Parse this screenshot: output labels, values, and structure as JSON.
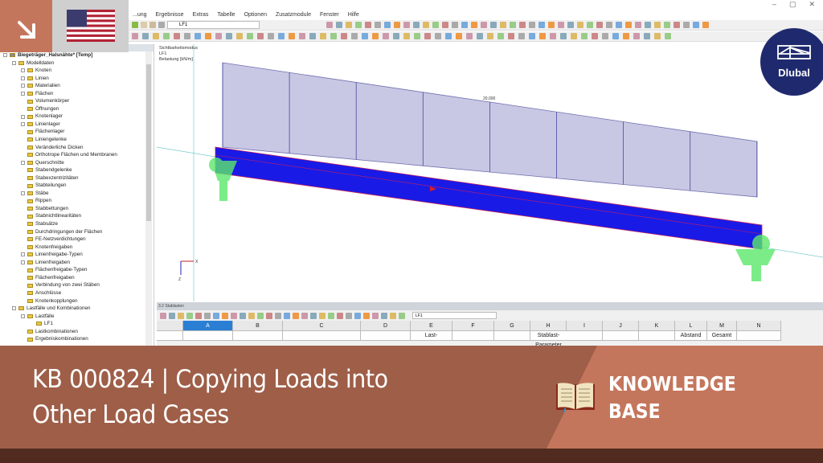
{
  "window": {
    "minimize": "–",
    "maximize": "▢",
    "close": "✕"
  },
  "menu": [
    "...ung",
    "Ergebnisse",
    "Extras",
    "Tabelle",
    "Optionen",
    "Zusatzmodule",
    "Fenster",
    "Hilfe"
  ],
  "toolbar": {
    "loadcase": "LF1"
  },
  "tree": {
    "root": "Biegeträger_Halsnähte* [Temp]",
    "items": [
      {
        "label": "Modelldaten",
        "level": 1,
        "expand": true
      },
      {
        "label": "Knoten",
        "level": 2,
        "expand": true
      },
      {
        "label": "Linien",
        "level": 2,
        "expand": true
      },
      {
        "label": "Materialien",
        "level": 2,
        "expand": true
      },
      {
        "label": "Flächen",
        "level": 2,
        "expand": true
      },
      {
        "label": "Volumenkörper",
        "level": 2
      },
      {
        "label": "Öffnungen",
        "level": 2
      },
      {
        "label": "Knotenlager",
        "level": 2,
        "expand": true
      },
      {
        "label": "Linienlager",
        "level": 2,
        "expand": true
      },
      {
        "label": "Flächenlager",
        "level": 2
      },
      {
        "label": "Liniengelenke",
        "level": 2
      },
      {
        "label": "Veränderliche Dicken",
        "level": 2
      },
      {
        "label": "Orthotrope Flächen und Membranen",
        "level": 2
      },
      {
        "label": "Querschnitte",
        "level": 2,
        "expand": true
      },
      {
        "label": "Stabendgelenke",
        "level": 2
      },
      {
        "label": "Stabexzentrizitäten",
        "level": 2
      },
      {
        "label": "Stabteilungen",
        "level": 2
      },
      {
        "label": "Stäbe",
        "level": 2,
        "expand": true
      },
      {
        "label": "Rippen",
        "level": 2
      },
      {
        "label": "Stabbettungen",
        "level": 2
      },
      {
        "label": "Stabnichtlinearitäten",
        "level": 2
      },
      {
        "label": "Stabsätze",
        "level": 2
      },
      {
        "label": "Durchdringungen der Flächen",
        "level": 2
      },
      {
        "label": "FE-Netzverdichtungen",
        "level": 2
      },
      {
        "label": "Knotenfreigaben",
        "level": 2
      },
      {
        "label": "Linienfreigabe-Typen",
        "level": 2,
        "expand": true
      },
      {
        "label": "Linienfreigaben",
        "level": 2,
        "expand": true
      },
      {
        "label": "Flächenfreigabe-Typen",
        "level": 2
      },
      {
        "label": "Flächenfreigaben",
        "level": 2
      },
      {
        "label": "Verbindung von zwei Stäben",
        "level": 2
      },
      {
        "label": "Anschlüsse",
        "level": 2
      },
      {
        "label": "Knotenkopplungen",
        "level": 2
      },
      {
        "label": "Lastfälle und Kombinationen",
        "level": 1,
        "expand": true
      },
      {
        "label": "Lastfälle",
        "level": 2,
        "expand": true
      },
      {
        "label": "LF1",
        "level": 3
      },
      {
        "label": "Lastkombinationen",
        "level": 2
      },
      {
        "label": "Ergebniskombinationen",
        "level": 2
      }
    ]
  },
  "viewport": {
    "mode": "Sichtbarkeitsmodus",
    "loadcase": "LF1",
    "load_label": "Belastung [kN/m]",
    "load_value": "20.000",
    "axis_x": "X",
    "axis_z": "Z"
  },
  "table": {
    "title": "3.2 Stablasten",
    "loadcase": "LF1",
    "columns": [
      "",
      "A",
      "B",
      "C",
      "D",
      "E",
      "F",
      "G",
      "H",
      "I",
      "J",
      "K",
      "L",
      "M",
      "N"
    ],
    "row2": [
      "",
      "",
      "",
      "",
      "",
      "Last-",
      "",
      "",
      "Stablast-Parameter",
      "",
      "",
      "",
      "Abstand",
      "Gesamt",
      ""
    ]
  },
  "banner": {
    "title_line1": "KB 000824 | Copying Loads into",
    "title_line2": "Other Load Cases",
    "kb_line1": "KNOWLEDGE",
    "kb_line2": "BASE"
  },
  "logo": {
    "text": "Dlubal"
  },
  "colors": {
    "accent": "#c4765c",
    "banner": "#9e5e48",
    "dark": "#512b20",
    "beam": "#1a1ae6",
    "load": "#c8c8e4",
    "logo": "#1f2a6e"
  }
}
